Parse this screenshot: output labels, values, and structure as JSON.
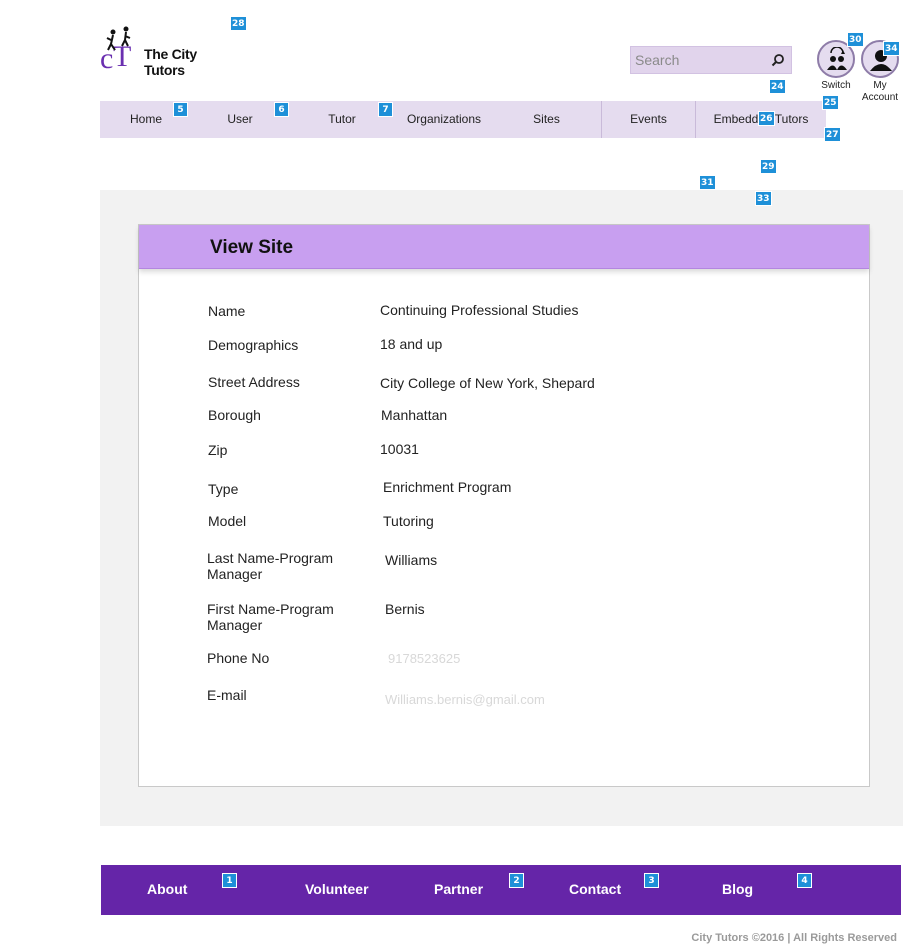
{
  "brand": {
    "logo_text": "The City Tutors"
  },
  "search": {
    "placeholder": "Search"
  },
  "header_buttons": {
    "switch_user": "Switch",
    "my_account_line1": "My",
    "my_account_line2": "Account"
  },
  "nav": {
    "items": [
      "Home",
      "User",
      "Tutor",
      "Organizations",
      "Sites",
      "Events",
      "Embedded Tutors"
    ]
  },
  "panel": {
    "title": "View Site",
    "fields": [
      {
        "label": "Name",
        "value": "Continuing Professional Studies"
      },
      {
        "label": "Demographics",
        "value": "18 and up"
      },
      {
        "label": "Street Address",
        "value": "City College of New York, Shepard"
      },
      {
        "label": "Borough",
        "value": "Manhattan"
      },
      {
        "label": "Zip",
        "value": "10031"
      },
      {
        "label": "Type",
        "value": "Enrichment Program"
      },
      {
        "label": "Model",
        "value": "Tutoring"
      },
      {
        "label": "Last Name-Program Manager",
        "value": "Williams"
      },
      {
        "label": "First Name-Program Manager",
        "value": "Bernis"
      },
      {
        "label": "Phone No",
        "value": "9178523625"
      },
      {
        "label": "E-mail",
        "value": "Williams.bernis@gmail.com"
      }
    ]
  },
  "footer": {
    "links": [
      "About",
      "Volunteer",
      "Partner",
      "Contact",
      "Blog"
    ],
    "copyright": "City Tutors ©2016 | All Rights Reserved"
  },
  "badges": [
    "28",
    "30",
    "34",
    "24",
    "25",
    "5",
    "6",
    "7",
    "26",
    "27",
    "29",
    "31",
    "33",
    "1",
    "2",
    "3",
    "4"
  ],
  "colors": {
    "nav_bg": "#e5dcef",
    "panel_header": "#c89ff0",
    "footer_bg": "#6525a8",
    "badge": "#1e90d8"
  }
}
